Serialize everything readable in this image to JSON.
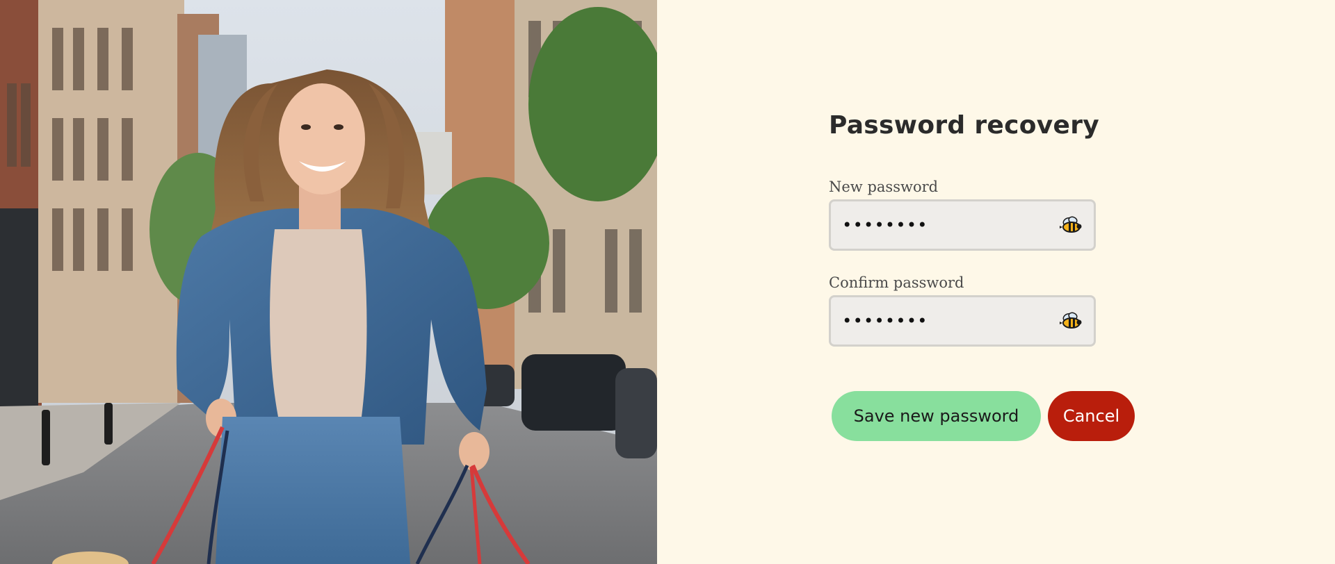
{
  "hero": {
    "image_alt": "Smiling woman in a denim jacket walking dogs on a city street"
  },
  "form": {
    "title": "Password recovery",
    "new_password": {
      "label": "New password",
      "value": "••••••••",
      "toggle_icon": "bee-icon"
    },
    "confirm_password": {
      "label": "Confirm password",
      "value": "••••••••",
      "toggle_icon": "bee-icon"
    },
    "buttons": {
      "save": "Save new password",
      "cancel": "Cancel"
    }
  },
  "colors": {
    "panel_background": "#fef8e8",
    "save_button": "#88df9d",
    "cancel_button": "#b91e0c",
    "input_background": "#efedea",
    "input_border": "#d3d1cc",
    "title_text": "#2b2b2b"
  }
}
